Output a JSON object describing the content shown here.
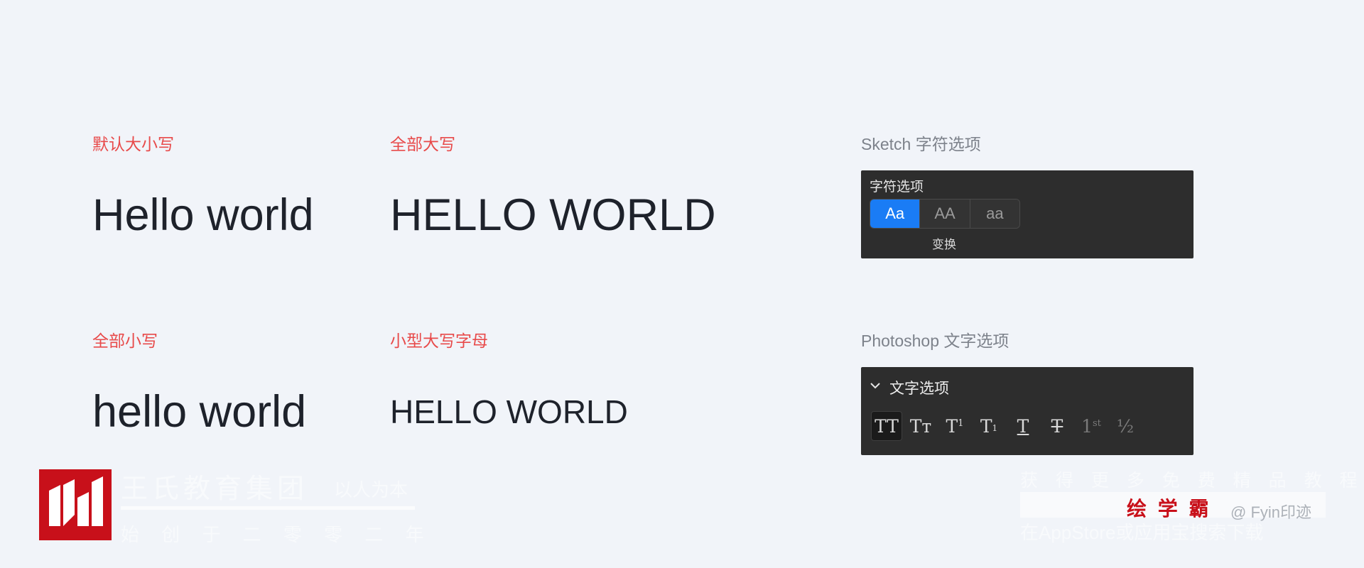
{
  "sections": {
    "default_case": {
      "label": "默认大小写",
      "sample": "Hello world"
    },
    "all_caps": {
      "label": "全部大写",
      "sample": "HELLO WORLD"
    },
    "all_lower": {
      "label": "全部小写",
      "sample": "hello world"
    },
    "small_caps": {
      "label": "小型大写字母",
      "sample": "HELLO WORLD"
    }
  },
  "sketch": {
    "heading": "Sketch 字符选项",
    "panel_title": "字符选项",
    "options": [
      {
        "label": "Aa",
        "active": true
      },
      {
        "label": "AA",
        "active": false
      },
      {
        "label": "aa",
        "active": false
      }
    ],
    "caption": "变换"
  },
  "photoshop": {
    "heading": "Photoshop 文字选项",
    "panel_title": "文字选项",
    "buttons": [
      {
        "icon": "all-caps-icon",
        "text": "TT",
        "active": true
      },
      {
        "icon": "small-caps-icon",
        "text": "Tт"
      },
      {
        "icon": "superscript-icon",
        "text": "T",
        "sup": "1"
      },
      {
        "icon": "subscript-icon",
        "text": "T",
        "sub": "1"
      },
      {
        "icon": "underline-icon",
        "text": "T"
      },
      {
        "icon": "strikethrough-icon",
        "text": "T"
      },
      {
        "icon": "ordinals-icon",
        "text": "1",
        "sup": "st",
        "dim": true
      },
      {
        "icon": "fractions-icon",
        "text": "½",
        "dim": true
      }
    ]
  },
  "watermark": {
    "org_name": "王氏教育集团",
    "motto": "以人为本",
    "founded": "始 创 于 二 零 零 二 年",
    "promo_line1": "获 得 更 多 免 费 精 品 教 程",
    "brand": "绘 学 霸",
    "author": "@ Fyin印迹",
    "promo_line2": "在AppStore或应用宝搜索下载"
  },
  "colors": {
    "background": "#f1f4f9",
    "accent_label": "#e84a4a",
    "active_blue": "#1a7cf5",
    "panel": "#2d2d2d",
    "logo_red": "#c8101a"
  }
}
